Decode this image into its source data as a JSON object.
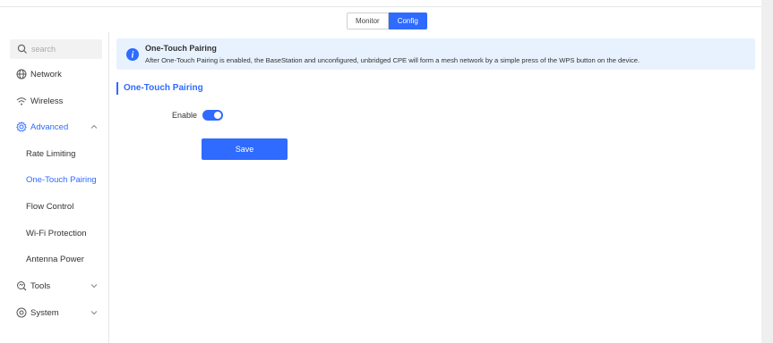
{
  "header": {
    "tabs": [
      {
        "label": "Monitor",
        "active": false
      },
      {
        "label": "Config",
        "active": true
      }
    ]
  },
  "sidebar": {
    "search_placeholder": "search",
    "items": [
      {
        "label": "Network",
        "icon": "globe-icon"
      },
      {
        "label": "Wireless",
        "icon": "wifi-icon"
      },
      {
        "label": "Advanced",
        "icon": "gear-icon",
        "expanded": true
      },
      {
        "label": "Rate Limiting"
      },
      {
        "label": "One-Touch Pairing",
        "selected": true
      },
      {
        "label": "Flow Control"
      },
      {
        "label": "Wi-Fi Protection"
      },
      {
        "label": "Antenna Power"
      },
      {
        "label": "Tools",
        "icon": "tools-icon"
      },
      {
        "label": "System",
        "icon": "system-icon"
      }
    ]
  },
  "banner": {
    "icon": "info-icon",
    "title": "One-Touch Pairing",
    "text": "After One-Touch Pairing is enabled, the BaseStation and unconfigured, unbridged CPE will form a mesh network by a simple press of the WPS button on the device."
  },
  "section": {
    "title": "One-Touch Pairing"
  },
  "form": {
    "enable_label": "Enable",
    "enable_value": true,
    "save_label": "Save"
  },
  "colors": {
    "accent": "#2f6bff",
    "banner_bg": "#e8f2fe"
  }
}
